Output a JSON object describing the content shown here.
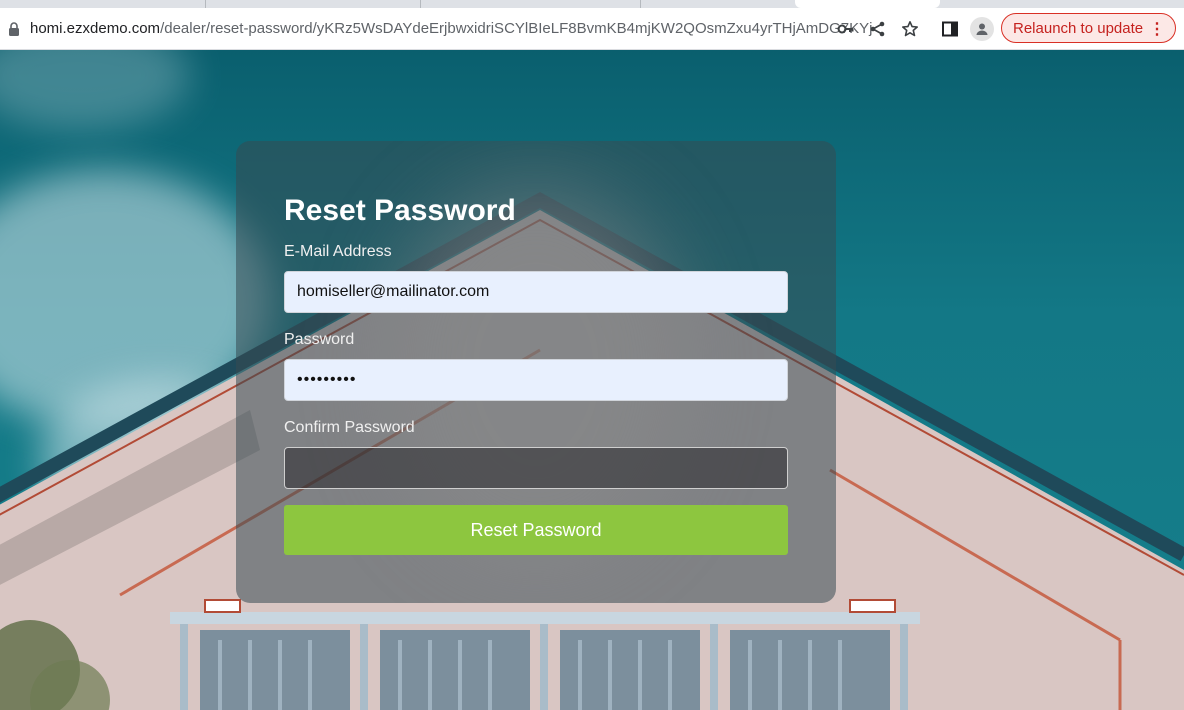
{
  "browser": {
    "url_host": "homi.ezxdemo.com",
    "url_path": "/dealer/reset-password/yKRz5WsDAYdeErjbwxidriSCYlBIeLF8BvmKB4mjKW2QOsmZxu4yrTHjAmDG7KYj",
    "relaunch_label": "Relaunch to update",
    "icons": [
      "lock-icon",
      "key-icon",
      "share-icon",
      "star-icon",
      "side-panel-icon",
      "profile-icon",
      "more-icon"
    ]
  },
  "form": {
    "title": "Reset Password",
    "email_label": "E-Mail Address",
    "email_value": "homiseller@mailinator.com",
    "password_label": "Password",
    "password_value": "•••••••••",
    "confirm_label": "Confirm Password",
    "confirm_value": "",
    "submit_label": "Reset Password"
  },
  "colors": {
    "accent_button": "#8dc63f",
    "relaunch_border": "#d93025",
    "sky": "#137886",
    "autofill_field": "#e8f0fe"
  }
}
